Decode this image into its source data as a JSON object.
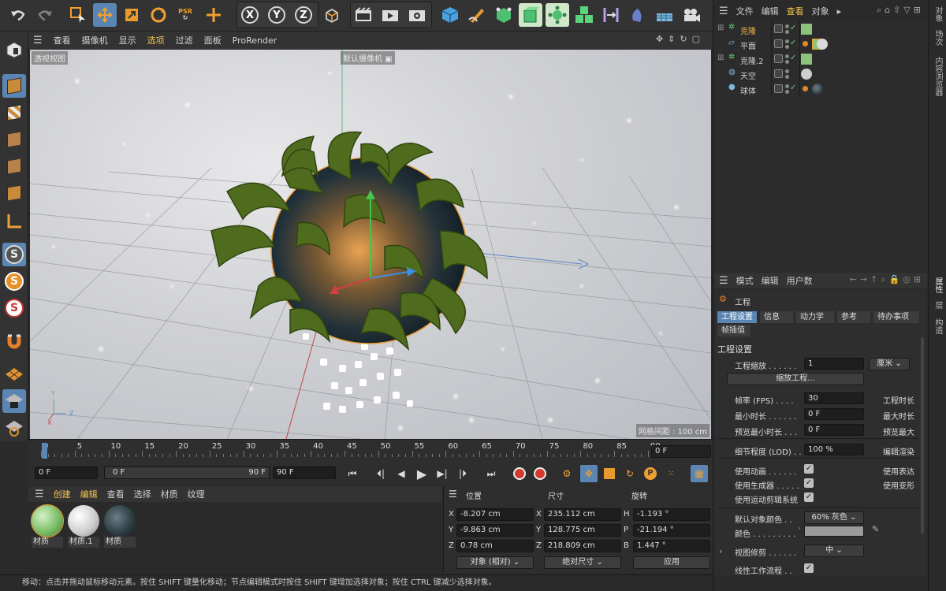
{
  "toolbar": {
    "icons": [
      "undo-icon",
      "redo-icon",
      "select-tool-icon",
      "move-tool-icon",
      "scale-tool-icon",
      "rotate-tool-icon",
      "psr-icon",
      "live-select-icon",
      "x-axis-icon",
      "y-axis-icon",
      "z-axis-icon",
      "coordinate-system-icon",
      "render-region-icon",
      "render-view-icon",
      "render-settings-icon",
      "cube-icon",
      "pen-icon",
      "subdivision-icon",
      "generator-icon",
      "array-icon",
      "cloner-icon",
      "deformer-icon",
      "scene-icon",
      "floor-icon",
      "camera-icon"
    ],
    "psr_label": "PSR",
    "x_label": "X",
    "y_label": "Y",
    "z_label": "Z"
  },
  "viewport_menu": {
    "items": [
      "查看",
      "摄像机",
      "显示",
      "选项",
      "过滤",
      "面板",
      "ProRender"
    ],
    "active": "选项"
  },
  "viewport": {
    "view_name": "透视视图",
    "camera_name": "默认摄像机",
    "grid_spacing": "网格间距 : 100 cm",
    "axes": {
      "x": "X",
      "y": "Y",
      "z": "Z"
    }
  },
  "timeline": {
    "ticks": [
      "0",
      "5",
      "10",
      "15",
      "20",
      "25",
      "30",
      "35",
      "40",
      "45",
      "50",
      "55",
      "60",
      "65",
      "70",
      "75",
      "80",
      "85",
      "90"
    ],
    "current_frame": "0 F"
  },
  "playback": {
    "start": "0 F",
    "range_start": "0 F",
    "range_end": "90 F",
    "end": "90 F"
  },
  "material_menu": {
    "items": [
      "创建",
      "编辑",
      "查看",
      "选择",
      "材质",
      "纹理"
    ]
  },
  "materials": [
    {
      "name": "材质",
      "color": "#8bc37a"
    },
    {
      "name": "材质.1",
      "color": "#d9d9d9"
    },
    {
      "name": "材质",
      "color": "#3a4a50"
    }
  ],
  "coordinates": {
    "headers": {
      "position": "位置",
      "size": "尺寸",
      "rotation": "旋转"
    },
    "position": {
      "x": "-8.207 cm",
      "y": "-9.863 cm",
      "z": "0.78 cm"
    },
    "size": {
      "x": "235.112 cm",
      "y": "128.775 cm",
      "z": "218.809 cm"
    },
    "rotation": {
      "h": "-1.193 °",
      "p": "-21.194 °",
      "b": "1.447 °"
    },
    "axis_labels": {
      "x": "X",
      "y": "Y",
      "z": "Z",
      "h": "H",
      "p": "P",
      "b": "B"
    },
    "mode_dropdown": "对象 (相对)",
    "size_dropdown": "绝对尺寸",
    "apply_button": "应用"
  },
  "status_bar": "移动：点击并拖动鼠标移动元素。按住 SHIFT 键量化移动；节点编辑模式时按住 SHIFT 键增加选择对象；按住 CTRL 键减少选择对象。",
  "object_menu": {
    "items": [
      "文件",
      "编辑",
      "查看",
      "对象"
    ],
    "active": "查看"
  },
  "objects": [
    {
      "name": "克隆",
      "selected": true,
      "icon": "cloner-icon"
    },
    {
      "name": "平面",
      "selected": false,
      "icon": "plane-icon"
    },
    {
      "name": "克隆.2",
      "selected": false,
      "icon": "cloner-icon"
    },
    {
      "name": "天空",
      "selected": false,
      "icon": "sky-icon"
    },
    {
      "name": "球体",
      "selected": false,
      "icon": "sphere-icon"
    }
  ],
  "right_tabs_top": [
    "对象",
    "场次",
    "内容浏览器"
  ],
  "right_tabs_bottom": [
    "属性",
    "层",
    "构造"
  ],
  "attr_menu": {
    "items": [
      "模式",
      "编辑",
      "用户数据"
    ]
  },
  "attributes": {
    "title": "工程",
    "tabs": [
      "工程设置",
      "信息",
      "动力学",
      "参考",
      "待办事项",
      "帧插值"
    ],
    "active_tab": "工程设置",
    "section": "工程设置",
    "scale_label": "工程缩放",
    "scale_value": "1",
    "scale_unit": "厘米",
    "scale_button": "缩放工程...",
    "fps_label": "帧率 (FPS)",
    "fps_value": "30",
    "project_time_label": "工程时长",
    "min_time_label": "最小时长",
    "min_time_value": "0 F",
    "max_time_label": "最大时长",
    "preview_min_label": "预览最小时长",
    "preview_min_value": "0 F",
    "preview_max_label": "预览最大",
    "lod_label": "细节程度 (LOD)",
    "lod_value": "100 %",
    "edit_render_label": "编辑渲染",
    "use_animation": "使用动画",
    "use_expression": "使用表达",
    "use_generators": "使用生成器",
    "use_deformers": "使用变形",
    "use_motion_system": "使用运动剪辑系统",
    "default_color_label": "默认对象颜色",
    "default_color_value": "60% 灰色",
    "color_label": "颜色",
    "view_clip_label": "视图修剪",
    "view_clip_value": "中",
    "linear_workflow_label": "线性工作流程"
  }
}
